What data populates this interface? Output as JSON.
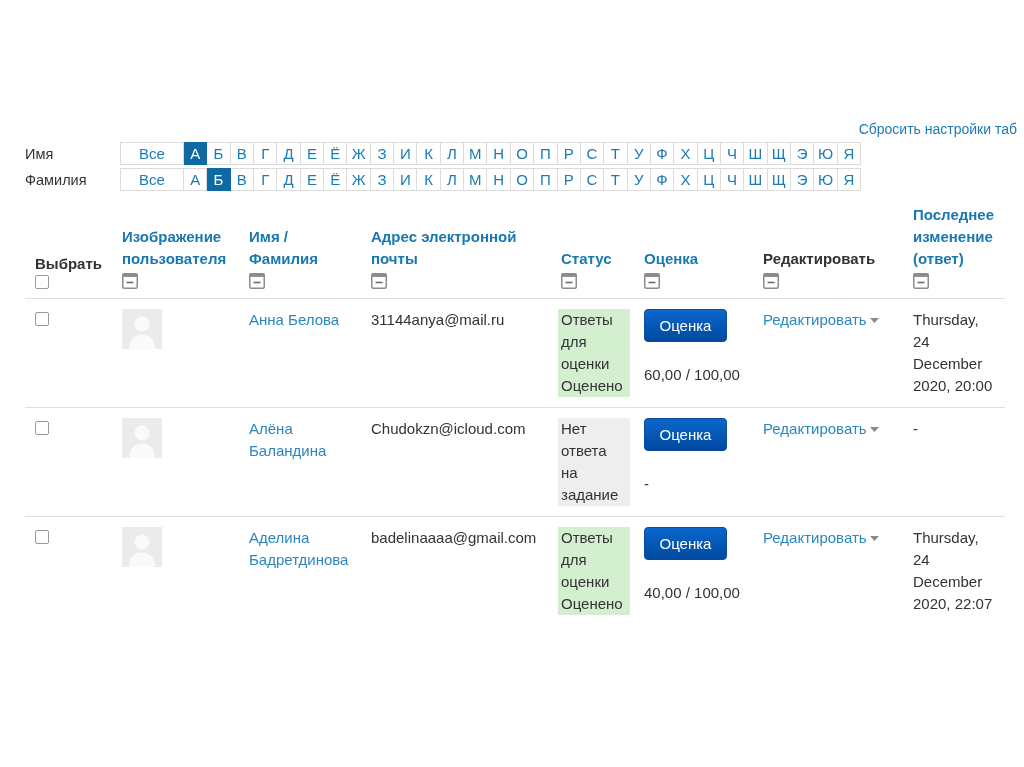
{
  "reset_link": "Сбросить настройки таб",
  "initials_filters": [
    {
      "label": "Имя",
      "items": [
        {
          "text": "Все",
          "selected": false
        },
        {
          "text": "А",
          "selected": true
        },
        {
          "text": "Б",
          "selected": false
        },
        {
          "text": "В",
          "selected": false
        },
        {
          "text": "Г",
          "selected": false
        },
        {
          "text": "Д",
          "selected": false
        },
        {
          "text": "Е",
          "selected": false
        },
        {
          "text": "Ё",
          "selected": false
        },
        {
          "text": "Ж",
          "selected": false
        },
        {
          "text": "З",
          "selected": false
        },
        {
          "text": "И",
          "selected": false
        },
        {
          "text": "К",
          "selected": false
        },
        {
          "text": "Л",
          "selected": false
        },
        {
          "text": "М",
          "selected": false
        },
        {
          "text": "Н",
          "selected": false
        },
        {
          "text": "О",
          "selected": false
        },
        {
          "text": "П",
          "selected": false
        },
        {
          "text": "Р",
          "selected": false
        },
        {
          "text": "С",
          "selected": false
        },
        {
          "text": "Т",
          "selected": false
        },
        {
          "text": "У",
          "selected": false
        },
        {
          "text": "Ф",
          "selected": false
        },
        {
          "text": "Х",
          "selected": false
        },
        {
          "text": "Ц",
          "selected": false
        },
        {
          "text": "Ч",
          "selected": false
        },
        {
          "text": "Ш",
          "selected": false
        },
        {
          "text": "Щ",
          "selected": false
        },
        {
          "text": "Э",
          "selected": false
        },
        {
          "text": "Ю",
          "selected": false
        },
        {
          "text": "Я",
          "selected": false
        }
      ]
    },
    {
      "label": "Фамилия",
      "items": [
        {
          "text": "Все",
          "selected": false
        },
        {
          "text": "А",
          "selected": false
        },
        {
          "text": "Б",
          "selected": true
        },
        {
          "text": "В",
          "selected": false
        },
        {
          "text": "Г",
          "selected": false
        },
        {
          "text": "Д",
          "selected": false
        },
        {
          "text": "Е",
          "selected": false
        },
        {
          "text": "Ё",
          "selected": false
        },
        {
          "text": "Ж",
          "selected": false
        },
        {
          "text": "З",
          "selected": false
        },
        {
          "text": "И",
          "selected": false
        },
        {
          "text": "К",
          "selected": false
        },
        {
          "text": "Л",
          "selected": false
        },
        {
          "text": "М",
          "selected": false
        },
        {
          "text": "Н",
          "selected": false
        },
        {
          "text": "О",
          "selected": false
        },
        {
          "text": "П",
          "selected": false
        },
        {
          "text": "Р",
          "selected": false
        },
        {
          "text": "С",
          "selected": false
        },
        {
          "text": "Т",
          "selected": false
        },
        {
          "text": "У",
          "selected": false
        },
        {
          "text": "Ф",
          "selected": false
        },
        {
          "text": "Х",
          "selected": false
        },
        {
          "text": "Ц",
          "selected": false
        },
        {
          "text": "Ч",
          "selected": false
        },
        {
          "text": "Ш",
          "selected": false
        },
        {
          "text": "Щ",
          "selected": false
        },
        {
          "text": "Э",
          "selected": false
        },
        {
          "text": "Ю",
          "selected": false
        },
        {
          "text": "Я",
          "selected": false
        }
      ]
    }
  ],
  "table": {
    "columns": [
      {
        "kind": "select",
        "label": "Выбрать",
        "checked": false
      },
      {
        "kind": "sortable",
        "label": "Изображение пользователя"
      },
      {
        "kind": "name_pair",
        "first": "Имя",
        "separator": "/",
        "second": "Фамилия"
      },
      {
        "kind": "sortable",
        "label": "Адрес электронной почты"
      },
      {
        "kind": "sortable",
        "label": "Статус"
      },
      {
        "kind": "sortable",
        "label": "Оценка"
      },
      {
        "kind": "plain",
        "label": "Редактировать"
      },
      {
        "kind": "sortable",
        "label": "Последнее изменение (ответ)"
      }
    ],
    "rows": [
      {
        "checked": false,
        "name": "Анна Белова",
        "email": "31144anya@mail.ru",
        "status": {
          "kind": "submitted",
          "text": "Ответы для оценки",
          "grading": "Оценено"
        },
        "grade_button": "Оценка",
        "grade": "60,00 / 100,00",
        "edit": "Редактировать",
        "last_modified": "Thursday, 24 December 2020, 20:00"
      },
      {
        "checked": false,
        "name": "Алёна Баландина",
        "email": "Chudokzn@icloud.com",
        "status": {
          "kind": "new",
          "text": "Нет ответа на задание"
        },
        "grade_button": "Оценка",
        "grade": "-",
        "edit": "Редактировать",
        "last_modified": "-"
      },
      {
        "checked": false,
        "name": "Аделина Бадретдинова",
        "email": "badelinaaaa@gmail.com",
        "status": {
          "kind": "submitted",
          "text": "Ответы для оценки",
          "grading": "Оценено"
        },
        "grade_button": "Оценка",
        "grade": "40,00 / 100,00",
        "edit": "Редактировать",
        "last_modified": "Thursday, 24 December 2020, 22:07"
      }
    ]
  }
}
